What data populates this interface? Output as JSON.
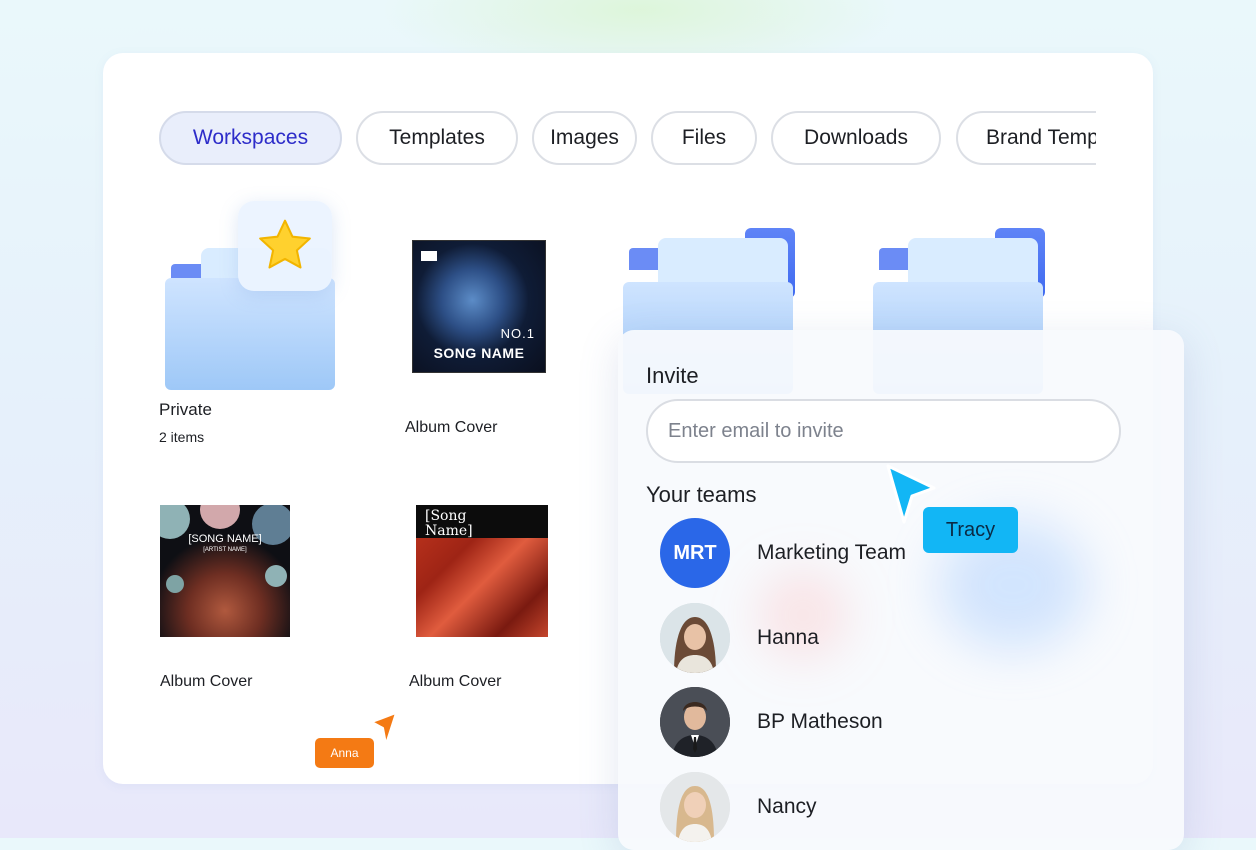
{
  "tabs": [
    {
      "label": "Workspaces",
      "active": true
    },
    {
      "label": "Templates",
      "active": false
    },
    {
      "label": "Images",
      "active": false
    },
    {
      "label": "Files",
      "active": false
    },
    {
      "label": "Downloads",
      "active": false
    },
    {
      "label": "Brand Templates",
      "active": false
    }
  ],
  "items": [
    {
      "type": "folder",
      "icon": "star-icon",
      "title": "Private",
      "subtitle": "2 items"
    },
    {
      "type": "cover",
      "title": "Album Cover",
      "art": {
        "label": "SONG NAME",
        "tag": "NO.1"
      }
    },
    {
      "type": "folder",
      "title": ""
    },
    {
      "type": "folder",
      "title": ""
    },
    {
      "type": "cover",
      "title": "Album Cover",
      "art": {
        "label": "[SONG NAME]",
        "sub": "[ARTIST NAME]"
      }
    },
    {
      "type": "cover",
      "title": "Album Cover",
      "art": {
        "label": "[Song Name]"
      }
    }
  ],
  "invite": {
    "title": "Invite",
    "placeholder": "Enter email to invite",
    "value": "",
    "teams_title": "Your teams",
    "members": [
      {
        "name": "Marketing Team",
        "initials": "MRT"
      },
      {
        "name": "Hanna"
      },
      {
        "name": "BP Matheson"
      },
      {
        "name": "Nancy"
      }
    ]
  },
  "cursors": [
    {
      "name": "Tracy",
      "color": "#12b6f5"
    },
    {
      "name": "Anna",
      "color": "#f47a14"
    }
  ],
  "colors": {
    "accent": "#2d2cc9",
    "active_tab_bg": "#e9eefb",
    "folder_blue": "#9ec8f7",
    "team_avatar": "#2a67e8",
    "star": "#ffd12e"
  }
}
